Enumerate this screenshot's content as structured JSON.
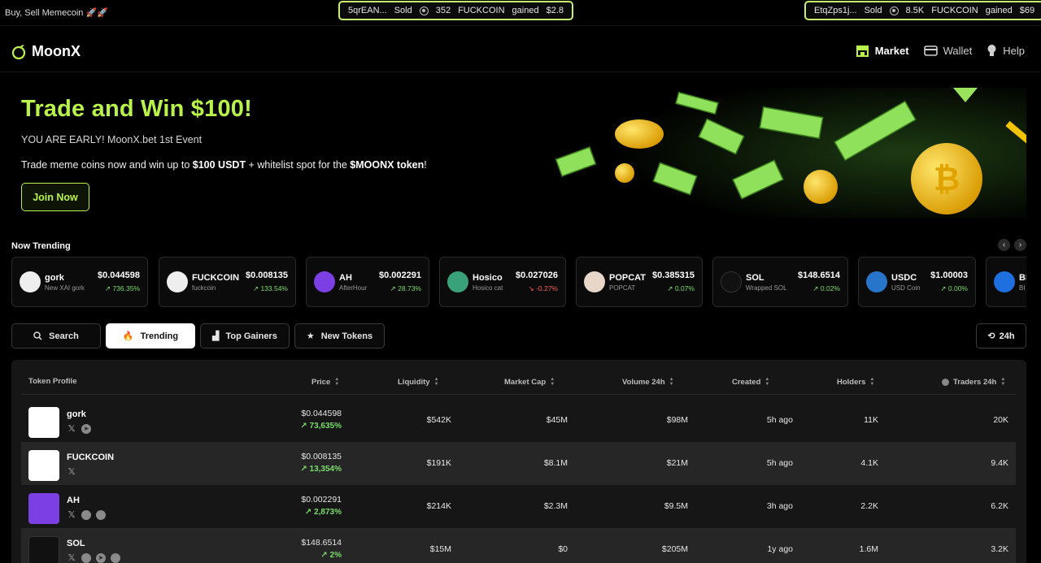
{
  "ticker": {
    "brand": "Buy, Sell Memecoin 🚀🚀",
    "items": [
      {
        "addr": "5qrEAN...",
        "action": "Sold",
        "amount": "352",
        "token": "FUCKCOIN",
        "verb": "gained",
        "value": "$2.8"
      },
      {
        "addr": "EtqZps1j...",
        "action": "Sold",
        "amount": "8.5K",
        "token": "FUCKCOIN",
        "verb": "gained",
        "value": "$69"
      }
    ]
  },
  "header": {
    "logo": "MoonX",
    "nav": [
      {
        "label": "Market",
        "icon": "store-icon",
        "active": true
      },
      {
        "label": "Wallet",
        "icon": "wallet-icon",
        "active": false
      },
      {
        "label": "Help",
        "icon": "lightbulb-icon",
        "active": false
      }
    ]
  },
  "hero": {
    "title": "Trade and Win $100!",
    "subtitle": "YOU ARE EARLY! MoonX.bet 1st Event",
    "desc_pre": "Trade meme coins now and win up to ",
    "desc_b1": "$100 USDT",
    "desc_mid": " + whitelist spot for the ",
    "desc_b2": "$MOONX token",
    "desc_post": "!",
    "cta": "Join Now"
  },
  "trending": {
    "title": "Now Trending",
    "cards": [
      {
        "name": "gork",
        "sub": "New XAI gork",
        "price": "$0.044598",
        "change": "736.35%",
        "dir": "up",
        "color": "#eeeeee"
      },
      {
        "name": "FUCKCOIN",
        "sub": "fuckcoin",
        "price": "$0.008135",
        "change": "133.54%",
        "dir": "up",
        "color": "#eeeeee"
      },
      {
        "name": "AH",
        "sub": "AfterHour",
        "price": "$0.002291",
        "change": "28.73%",
        "dir": "up",
        "color": "#7b3fe4"
      },
      {
        "name": "Hosico",
        "sub": "Hosico cat",
        "price": "$0.027026",
        "change": "-0.27%",
        "dir": "down",
        "color": "#3aa27a"
      },
      {
        "name": "POPCAT",
        "sub": "POPCAT",
        "price": "$0.385315",
        "change": "0.07%",
        "dir": "up",
        "color": "#e8d6c8"
      },
      {
        "name": "SOL",
        "sub": "Wrapped SOL",
        "price": "$148.6514",
        "change": "0.02%",
        "dir": "up",
        "color": "#111111"
      },
      {
        "name": "USDC",
        "sub": "USD Coin",
        "price": "$1.00003",
        "change": "0.00%",
        "dir": "up",
        "color": "#2775ca"
      },
      {
        "name": "BI",
        "sub": "BI",
        "price": "",
        "change": "",
        "dir": "up",
        "color": "#1e6fe0"
      }
    ]
  },
  "filters": {
    "search": "Search",
    "trending": "Trending",
    "top_gainers": "Top Gainers",
    "new_tokens": "New Tokens",
    "range": "24h"
  },
  "table": {
    "headers": {
      "token": "Token Profile",
      "price": "Price",
      "liquidity": "Liquidity",
      "market_cap": "Market Cap",
      "volume": "Volume 24h",
      "created": "Created",
      "holders": "Holders",
      "traders": "Traders 24h"
    },
    "rows": [
      {
        "name": "gork",
        "price": "$0.044598",
        "change": "73,635%",
        "liquidity": "$542K",
        "mcap": "$45M",
        "volume": "$98M",
        "created": "5h ago",
        "holders": "11K",
        "traders": "20K",
        "color": "#eeeeee",
        "socials": [
          "X",
          "telegram"
        ]
      },
      {
        "name": "FUCKCOIN",
        "price": "$0.008135",
        "change": "13,354%",
        "liquidity": "$191K",
        "mcap": "$8.1M",
        "volume": "$21M",
        "created": "5h ago",
        "holders": "4.1K",
        "traders": "9.4K",
        "color": "#eeeeee",
        "socials": [
          "X"
        ]
      },
      {
        "name": "AH",
        "price": "$0.002291",
        "change": "2,873%",
        "liquidity": "$214K",
        "mcap": "$2.3M",
        "volume": "$9.5M",
        "created": "3h ago",
        "holders": "2.2K",
        "traders": "6.2K",
        "color": "#7b3fe4",
        "socials": [
          "X",
          "website",
          "discord"
        ]
      },
      {
        "name": "SOL",
        "price": "$148.6514",
        "change": "2%",
        "liquidity": "$15M",
        "mcap": "$0",
        "volume": "$205M",
        "created": "1y ago",
        "holders": "1.6M",
        "traders": "3.2K",
        "color": "#111111",
        "socials": [
          "X",
          "website",
          "telegram",
          "discord"
        ]
      }
    ]
  },
  "colors": {
    "accent": "#b8f24a",
    "up": "#7bdc6a",
    "down": "#ff5b5b"
  }
}
